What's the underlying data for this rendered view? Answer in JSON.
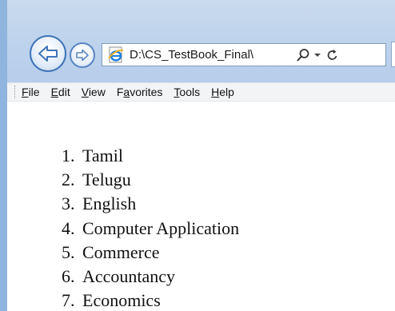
{
  "window": {
    "frame_color": "#8fb4de",
    "chrome_color": "#c3d7ee"
  },
  "toolbar": {
    "back_icon": "back-arrow-icon",
    "forward_icon": "forward-arrow-icon",
    "address": "D:\\CS_TestBook_Final\\",
    "search_icon": "search-icon",
    "dropdown_icon": "chevron-down-icon",
    "refresh_icon": "refresh-icon",
    "page_icon": "ie-page-icon"
  },
  "menu": {
    "items": [
      {
        "accel": "F",
        "rest": "ile"
      },
      {
        "accel": "E",
        "rest": "dit"
      },
      {
        "accel": "V",
        "rest": "iew"
      },
      {
        "pre": "F",
        "accel": "a",
        "rest": "vorites"
      },
      {
        "accel": "T",
        "rest": "ools"
      },
      {
        "accel": "H",
        "rest": "elp"
      }
    ]
  },
  "content": {
    "list": [
      {
        "num": "1.",
        "text": "Tamil"
      },
      {
        "num": "2.",
        "text": "Telugu"
      },
      {
        "num": "3.",
        "text": "English"
      },
      {
        "num": "4.",
        "text": "Computer Application"
      },
      {
        "num": "5.",
        "text": "Commerce"
      },
      {
        "num": "6.",
        "text": "Accountancy"
      },
      {
        "num": "7.",
        "text": "Economics"
      }
    ]
  },
  "colors": {
    "accent": "#3f73b8",
    "ie_blue": "#1e7fd8",
    "ie_gold": "#f2b01e"
  }
}
